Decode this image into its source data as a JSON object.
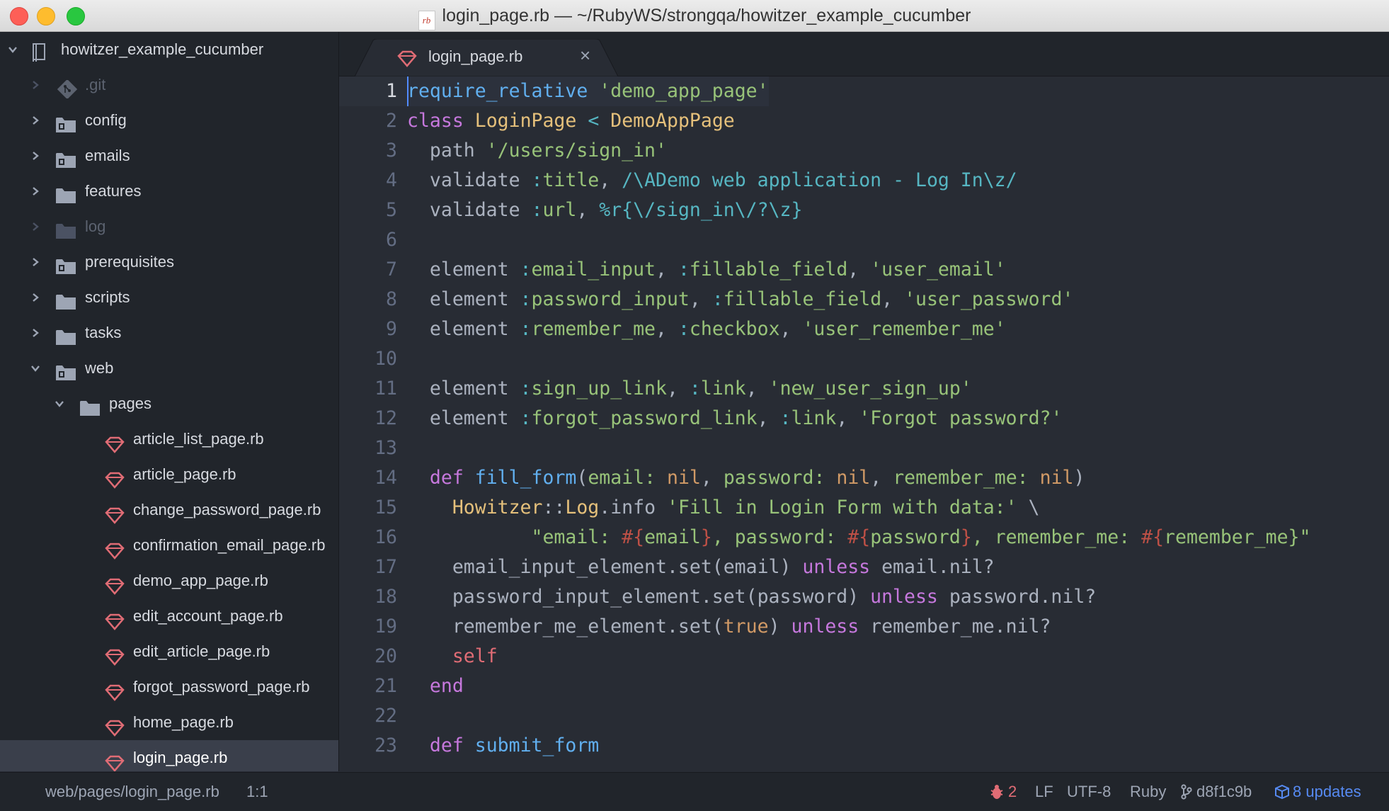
{
  "window": {
    "title": "login_page.rb — ~/RubyWS/strongqa/howitzer_example_cucumber",
    "title_icon": "rb"
  },
  "tree": {
    "root": "howitzer_example_cucumber",
    "items": [
      {
        "label": ".git",
        "kind": "git"
      },
      {
        "label": "config",
        "kind": "folder"
      },
      {
        "label": "emails",
        "kind": "folder"
      },
      {
        "label": "features",
        "kind": "folder"
      },
      {
        "label": "log",
        "kind": "folder"
      },
      {
        "label": "prerequisites",
        "kind": "folder"
      },
      {
        "label": "scripts",
        "kind": "folder"
      },
      {
        "label": "tasks",
        "kind": "folder"
      },
      {
        "label": "web",
        "kind": "folder"
      },
      {
        "label": "pages",
        "kind": "folder"
      },
      {
        "label": "article_list_page.rb",
        "kind": "ruby-file"
      },
      {
        "label": "article_page.rb",
        "kind": "ruby-file"
      },
      {
        "label": "change_password_page.rb",
        "kind": "ruby-file"
      },
      {
        "label": "confirmation_email_page.rb",
        "kind": "ruby-file"
      },
      {
        "label": "demo_app_page.rb",
        "kind": "ruby-file"
      },
      {
        "label": "edit_account_page.rb",
        "kind": "ruby-file"
      },
      {
        "label": "edit_article_page.rb",
        "kind": "ruby-file"
      },
      {
        "label": "forgot_password_page.rb",
        "kind": "ruby-file"
      },
      {
        "label": "home_page.rb",
        "kind": "ruby-file"
      },
      {
        "label": "login_page.rb",
        "kind": "ruby-file"
      }
    ]
  },
  "tab": {
    "label": "login_page.rb",
    "close": "×"
  },
  "editor": {
    "lines": [
      [
        [
          "fn",
          "require_relative"
        ],
        [
          "p",
          " "
        ],
        [
          "str",
          "'demo_app_page'"
        ]
      ],
      [
        [
          "kw",
          "class"
        ],
        [
          "p",
          " "
        ],
        [
          "cls",
          "LoginPage"
        ],
        [
          "p",
          " "
        ],
        [
          "op",
          "<"
        ],
        [
          "p",
          " "
        ],
        [
          "cls",
          "DemoAppPage"
        ]
      ],
      [
        [
          "p",
          "  path "
        ],
        [
          "str",
          "'/users/sign_in'"
        ]
      ],
      [
        [
          "p",
          "  validate "
        ],
        [
          "sym",
          ":"
        ],
        [
          "str",
          "title"
        ],
        [
          "p",
          ", "
        ],
        [
          "re",
          "/\\ADemo web application - Log In\\z/"
        ]
      ],
      [
        [
          "p",
          "  validate "
        ],
        [
          "sym",
          ":"
        ],
        [
          "str",
          "url"
        ],
        [
          "p",
          ", "
        ],
        [
          "re",
          "%r{\\/sign_in\\/?\\z}"
        ]
      ],
      [],
      [
        [
          "p",
          "  element "
        ],
        [
          "sym",
          ":"
        ],
        [
          "str",
          "email_input"
        ],
        [
          "p",
          ", "
        ],
        [
          "sym",
          ":"
        ],
        [
          "str",
          "fillable_field"
        ],
        [
          "p",
          ", "
        ],
        [
          "str",
          "'user_email'"
        ]
      ],
      [
        [
          "p",
          "  element "
        ],
        [
          "sym",
          ":"
        ],
        [
          "str",
          "password_input"
        ],
        [
          "p",
          ", "
        ],
        [
          "sym",
          ":"
        ],
        [
          "str",
          "fillable_field"
        ],
        [
          "p",
          ", "
        ],
        [
          "str",
          "'user_password'"
        ]
      ],
      [
        [
          "p",
          "  element "
        ],
        [
          "sym",
          ":"
        ],
        [
          "str",
          "remember_me"
        ],
        [
          "p",
          ", "
        ],
        [
          "sym",
          ":"
        ],
        [
          "str",
          "checkbox"
        ],
        [
          "p",
          ", "
        ],
        [
          "str",
          "'user_remember_me'"
        ]
      ],
      [],
      [
        [
          "p",
          "  element "
        ],
        [
          "sym",
          ":"
        ],
        [
          "str",
          "sign_up_link"
        ],
        [
          "p",
          ", "
        ],
        [
          "sym",
          ":"
        ],
        [
          "str",
          "link"
        ],
        [
          "p",
          ", "
        ],
        [
          "str",
          "'new_user_sign_up'"
        ]
      ],
      [
        [
          "p",
          "  element "
        ],
        [
          "sym",
          ":"
        ],
        [
          "str",
          "forgot_password_link"
        ],
        [
          "p",
          ", "
        ],
        [
          "sym",
          ":"
        ],
        [
          "str",
          "link"
        ],
        [
          "p",
          ", "
        ],
        [
          "str",
          "'Forgot password?'"
        ]
      ],
      [],
      [
        [
          "p",
          "  "
        ],
        [
          "kw",
          "def"
        ],
        [
          "p",
          " "
        ],
        [
          "fn",
          "fill_form"
        ],
        [
          "p",
          "("
        ],
        [
          "str",
          "email:"
        ],
        [
          "p",
          " "
        ],
        [
          "const",
          "nil"
        ],
        [
          "p",
          ", "
        ],
        [
          "str",
          "password:"
        ],
        [
          "p",
          " "
        ],
        [
          "const",
          "nil"
        ],
        [
          "p",
          ", "
        ],
        [
          "str",
          "remember_me:"
        ],
        [
          "p",
          " "
        ],
        [
          "const",
          "nil"
        ],
        [
          "p",
          ")"
        ]
      ],
      [
        [
          "p",
          "    "
        ],
        [
          "cls",
          "Howitzer"
        ],
        [
          "p",
          "::"
        ],
        [
          "cls",
          "Log"
        ],
        [
          "p",
          ".info "
        ],
        [
          "str",
          "'Fill in Login Form with data:'"
        ],
        [
          "p",
          " \\"
        ]
      ],
      [
        [
          "p",
          "           "
        ],
        [
          "str",
          "\"email: "
        ],
        [
          "interp",
          "#{"
        ],
        [
          "str",
          "email"
        ],
        [
          "interp",
          "}"
        ],
        [
          "str",
          ", password: "
        ],
        [
          "interp",
          "#{"
        ],
        [
          "str",
          "password"
        ],
        [
          "interp",
          "}"
        ],
        [
          "str",
          ", remember_me: "
        ],
        [
          "interp",
          "#{"
        ],
        [
          "str",
          "remember_me}\""
        ]
      ],
      [
        [
          "p",
          "    email_input_element.set(email) "
        ],
        [
          "kw",
          "unless"
        ],
        [
          "p",
          " email.nil?"
        ]
      ],
      [
        [
          "p",
          "    password_input_element.set(password) "
        ],
        [
          "kw",
          "unless"
        ],
        [
          "p",
          " password.nil?"
        ]
      ],
      [
        [
          "p",
          "    remember_me_element.set("
        ],
        [
          "const",
          "true"
        ],
        [
          "p",
          ") "
        ],
        [
          "kw",
          "unless"
        ],
        [
          "p",
          " remember_me.nil?"
        ]
      ],
      [
        [
          "p",
          "    "
        ],
        [
          "self",
          "self"
        ]
      ],
      [
        [
          "p",
          "  "
        ],
        [
          "kw",
          "end"
        ]
      ],
      [],
      [
        [
          "p",
          "  "
        ],
        [
          "kw",
          "def"
        ],
        [
          "p",
          " "
        ],
        [
          "fn",
          "submit_form"
        ]
      ]
    ]
  },
  "status": {
    "path": "web/pages/login_page.rb",
    "position": "1:1",
    "issues": "2",
    "line_ending": "LF",
    "encoding": "UTF-8",
    "grammar": "Ruby",
    "commit": "d8f1c9b",
    "updates": "8 updates"
  },
  "colors": {
    "editor_bg": "#282c34",
    "sidebar_bg": "#21252b",
    "keyword": "#c678dd",
    "string": "#98c379",
    "class": "#e5c07b",
    "function": "#61afef",
    "ruby_red": "#e06c75",
    "accent_blue": "#568af2"
  }
}
